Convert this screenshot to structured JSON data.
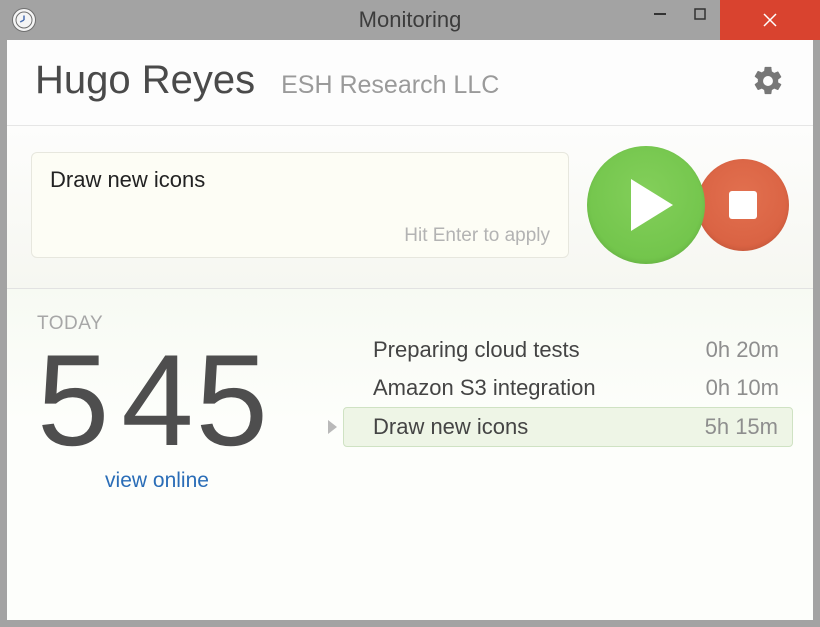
{
  "window": {
    "title": "Monitoring"
  },
  "header": {
    "user_name": "Hugo Reyes",
    "company": "ESH Research LLC"
  },
  "input": {
    "value": "Draw new icons",
    "hint": "Hit Enter to apply"
  },
  "today": {
    "label": "TODAY",
    "hours": "5",
    "minutes": "45",
    "view_online": "view online",
    "tasks": [
      {
        "name": "Preparing cloud tests",
        "duration": "0h 20m",
        "active": false
      },
      {
        "name": "Amazon S3 integration",
        "duration": "0h 10m",
        "active": false
      },
      {
        "name": "Draw new icons",
        "duration": "5h 15m",
        "active": true
      }
    ]
  }
}
